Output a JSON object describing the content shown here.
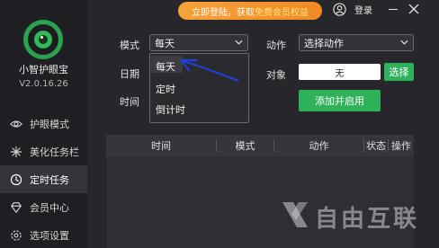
{
  "app": {
    "name": "小智护眼宝",
    "version": "V2.0.16.26"
  },
  "topbar": {
    "promo_prefix": "立即登陆，获取",
    "promo_highlight": "免费会员权益",
    "login_label": "登录",
    "icons": [
      "user-icon",
      "minimize-icon",
      "close-icon"
    ]
  },
  "sidebar": {
    "items": [
      {
        "label": "护眼模式",
        "icon": "eye-icon",
        "active": false
      },
      {
        "label": "美化任务栏",
        "icon": "sparkle-icon",
        "active": false
      },
      {
        "label": "定时任务",
        "icon": "clock-icon",
        "active": true
      },
      {
        "label": "会员中心",
        "icon": "diamond-icon",
        "active": false
      },
      {
        "label": "选项设置",
        "icon": "settings-icon",
        "active": false
      }
    ]
  },
  "form": {
    "mode_label": "模式",
    "mode_value": "每天",
    "date_label": "日期",
    "time_label": "时间",
    "action_label": "动作",
    "action_value": "选择动作",
    "target_label": "对象",
    "target_value": "无",
    "select_button": "选择",
    "add_button": "添加并启用"
  },
  "mode_dropdown": {
    "options": [
      "每天",
      "定时",
      "倒计时"
    ],
    "highlighted": "每天"
  },
  "table": {
    "columns": [
      "时间",
      "模式",
      "动作",
      "状态",
      "操作"
    ]
  },
  "watermark": {
    "text": "自由互联",
    "icon": "x-logo-icon"
  },
  "colors": {
    "accent_green": "#2fb15a",
    "promo_orange": "#f39a30",
    "annotation_blue": "#1e3fd6"
  }
}
